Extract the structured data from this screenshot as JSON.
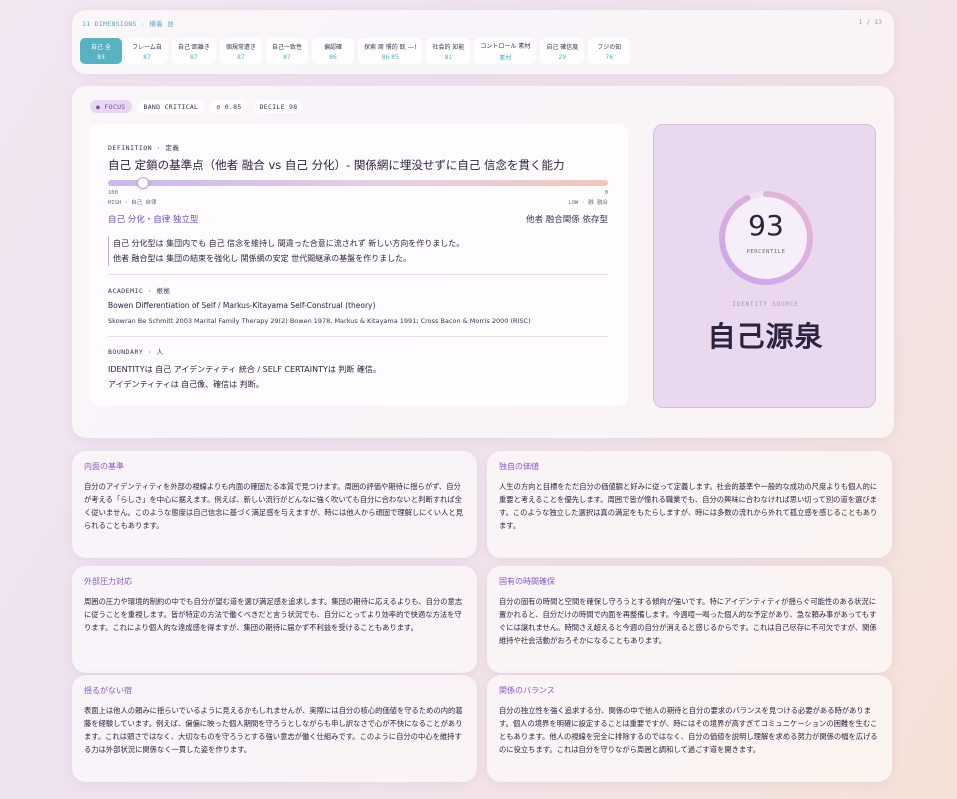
{
  "dimensions": {
    "title": "11 DIMENSIONS · 横着 並",
    "page": "1 / 13",
    "tabs": [
      {
        "label": "自己 全",
        "value": "93",
        "active": true
      },
      {
        "label": "フレーム自",
        "value": "87"
      },
      {
        "label": "自己 距離き",
        "value": "87"
      },
      {
        "label": "個規常遭き",
        "value": "87"
      },
      {
        "label": "自己一致性",
        "value": "87"
      },
      {
        "label": "偏認確",
        "value": "86"
      },
      {
        "label": "探索 周 慣的 既 ---!",
        "value": "86   85"
      },
      {
        "label": "社会的 知能",
        "value": "81"
      },
      {
        "label": "コントロール 素材",
        "value": "素材"
      },
      {
        "label": "自己 確信度",
        "value": "29"
      },
      {
        "label": "フジの知",
        "value": "76"
      }
    ]
  },
  "focus": {
    "chips": [
      "● FOCUS",
      "BAND CRITICAL",
      "σ 0.85",
      "DECILE 98"
    ],
    "definition_label": "DEFINITION · 定義",
    "definition_title": "自己 定鎖の基準点（他者 融合 vs 自己 分化）- 関係網に埋没せずに自己 信念を貫く能力",
    "slider": {
      "value_fraction": 0.07,
      "left_num": "100",
      "right_num": "0",
      "left_caption": "HIGH · 自己 自律",
      "right_caption": "LOW · 融 融合"
    },
    "pole_left": "自己 分化・自律 独立型",
    "pole_right": "他者 融合関係 依存型",
    "description": [
      "自己 分化型は 集団内でも 自己 信念を維持し 間違った合意に流されず 新しい方向を作りました。",
      "他者 融合型は 集団の結束を強化し 関係網の安定 世代間継承の基盤を作りました。"
    ],
    "academic_label": "ACADEMIC · 根拠",
    "academic_title": "Bowen Differentiation of Self / Markus-Kitayama Self-Construal (theory)",
    "academic_refs": "Skowran Be Schmitt 2003 Marital Family Therapy 29(2) Bowen 1978, Markus & Kitayama 1991; Cross Bacon & Morris 2000 (RISC)",
    "boundary_label": "BOUNDARY · 人",
    "boundary": [
      "IDENTITYは 自己 アイデンティティ 統合 / SELF CERTAINTYは 判断 確信。",
      "アイデンティティは 自己像、確信は 判断。"
    ]
  },
  "identity": {
    "percentile": "93",
    "percentile_fraction": 0.93,
    "percentile_label": "PERCENTILE",
    "source_label": "IDENTITY SOURCE",
    "name": "自己源泉"
  },
  "traits": [
    {
      "title": "内面の基準",
      "body": "自分のアイデンティティを外部の視線よりも内面の確固たる本質で見つけます。周囲の評価や期待に揺らがず、自分が考える「らしさ」を中心に据えます。例えば、新しい流行がどんなに強く吹いても自分に合わないと判断すれば全く従いません。このような態度は自己信念に基づく満足感を与えますが、時には他人から頑固で理解しにくい人と見られることもあります。"
    },
    {
      "title": "独自の価値",
      "body": "人生の方向と目標をただ自分の価値観と好みに従って定義します。社会的基準や一般的な成功の尺度よりも個人的に重要と考えることを優先します。周囲で皆が憧れる職業でも、自分の興味に合わなければ思い切って別の道を選びます。このような独立した選択は真の満足をもたらしますが、時には多数の流れから外れて孤立感を感じることもあります。"
    },
    {
      "title": "外部圧力対応",
      "body": "周囲の圧力や環境的制約の中でも自分が望む道を選び満足感を追求します。集団の期待に応えるよりも、自分の意志に従うことを重視します。皆が特定の方法で働くべきだと言う状況でも、自分にとってより効率的で快適な方法を守ります。これにより個人的な達成感を得ますが、集団の期待に届かず不利益を受けることもあります。"
    },
    {
      "title": "固有の時間確保",
      "body": "自分の固有の時間と空間を確保し守ろうとする傾向が強いです。特にアイデンティティが揺らぐ可能性のある状況に置かれると、自分だけの時間で内面を再整備します。今週喧一喝った個人的な予定があり、急な頼み事があってもすぐには譲れません。時間さえ超えると今週の自分が消えると感じるからです。これは自己尽存に不可欠ですが、関係維持や社会活動がおろそかになることもあります。"
    },
    {
      "title": "揺るがない宿",
      "body": "表面上は他人の頼みに揺らいでいるように見えるかもしれませんが、実際には自分の核心的価値を守るための内的葛藤を経験しています。例えば、偏偏に映った個人期間を守ろうとしながらも申し訳なさで心が不快になることがあります。これは頭さではなく、大切なものを守ろうとする強い意志が働く仕組みです。このように自分の中心を維持する力は外部状況に関係なく一貫した姿を作ります。"
    },
    {
      "title": "関係のバランス",
      "body": "自分の独立性を強く追求する分、関係の中で他人の期待と自分の要求のバランスを見つける必要がある時があります。個人の境界を明確に設定することは重要ですが、時にはその境界が高すぎてコミュニケーションの困難を生むこともあります。他人の視線を完全に排除するのではなく、自分の価値を説明し理解を求める努力が関係の幅を広げるのに役立ちます。これは自分を守りながら周囲と調和して過ごす道を開きます。"
    }
  ]
}
